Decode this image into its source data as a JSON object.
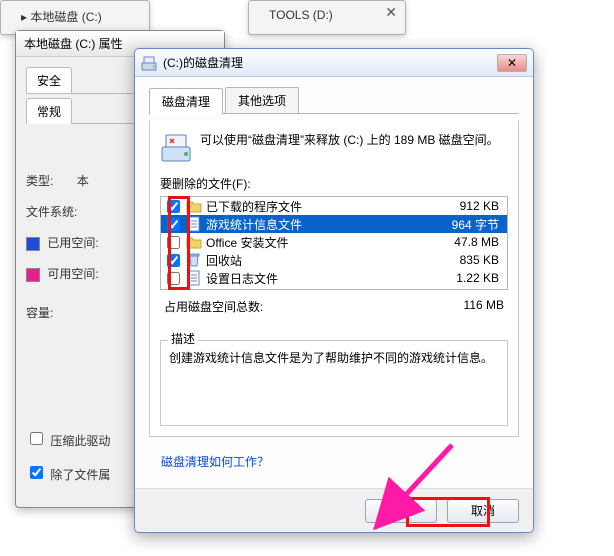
{
  "bg_fragments": {
    "frag1_label": "▸ 本地磁盘 (C:)",
    "frag2_label": "TOOLS (D:)"
  },
  "properties_window": {
    "title": "本地磁盘 (C:) 属性",
    "tabs": {
      "security": "安全",
      "general": "常规"
    },
    "fields": {
      "type_label": "类型:",
      "type_value_partial": "本",
      "filesystem_label": "文件系统:",
      "used_label": "已用空间:",
      "free_label": "可用空间:",
      "capacity_label": "容量:",
      "compress_label": "压缩此驱动",
      "index_label": "除了文件属"
    },
    "compress_checked": false,
    "index_checked": true
  },
  "disk_cleanup": {
    "title": "(C:)的磁盘清理",
    "tabs": {
      "main": "磁盘清理",
      "more": "其他选项"
    },
    "info_text": "可以使用“磁盘清理”来释放  (C:) 上的 189 MB 磁盘空间。",
    "list_label": "要删除的文件(F):",
    "files": [
      {
        "checked": true,
        "selected": false,
        "name": "已下载的程序文件",
        "size": "912 KB",
        "icon": "folder"
      },
      {
        "checked": true,
        "selected": true,
        "name": "游戏统计信息文件",
        "size": "964 字节",
        "icon": "doc"
      },
      {
        "checked": false,
        "selected": false,
        "name": "Office 安装文件",
        "size": "47.8 MB",
        "icon": "folder"
      },
      {
        "checked": true,
        "selected": false,
        "name": "回收站",
        "size": "835 KB",
        "icon": "bin"
      },
      {
        "checked": false,
        "selected": false,
        "name": "设置日志文件",
        "size": "1.22 KB",
        "icon": "doc"
      }
    ],
    "total_label": "占用磁盘空间总数:",
    "total_value": "116 MB",
    "desc_label": "描述",
    "desc_text": "创建游戏统计信息文件是为了帮助维护不同的游戏统计信息。",
    "link_text": "磁盘清理如何工作？",
    "buttons": {
      "ok": "确定",
      "cancel": "取消"
    }
  }
}
